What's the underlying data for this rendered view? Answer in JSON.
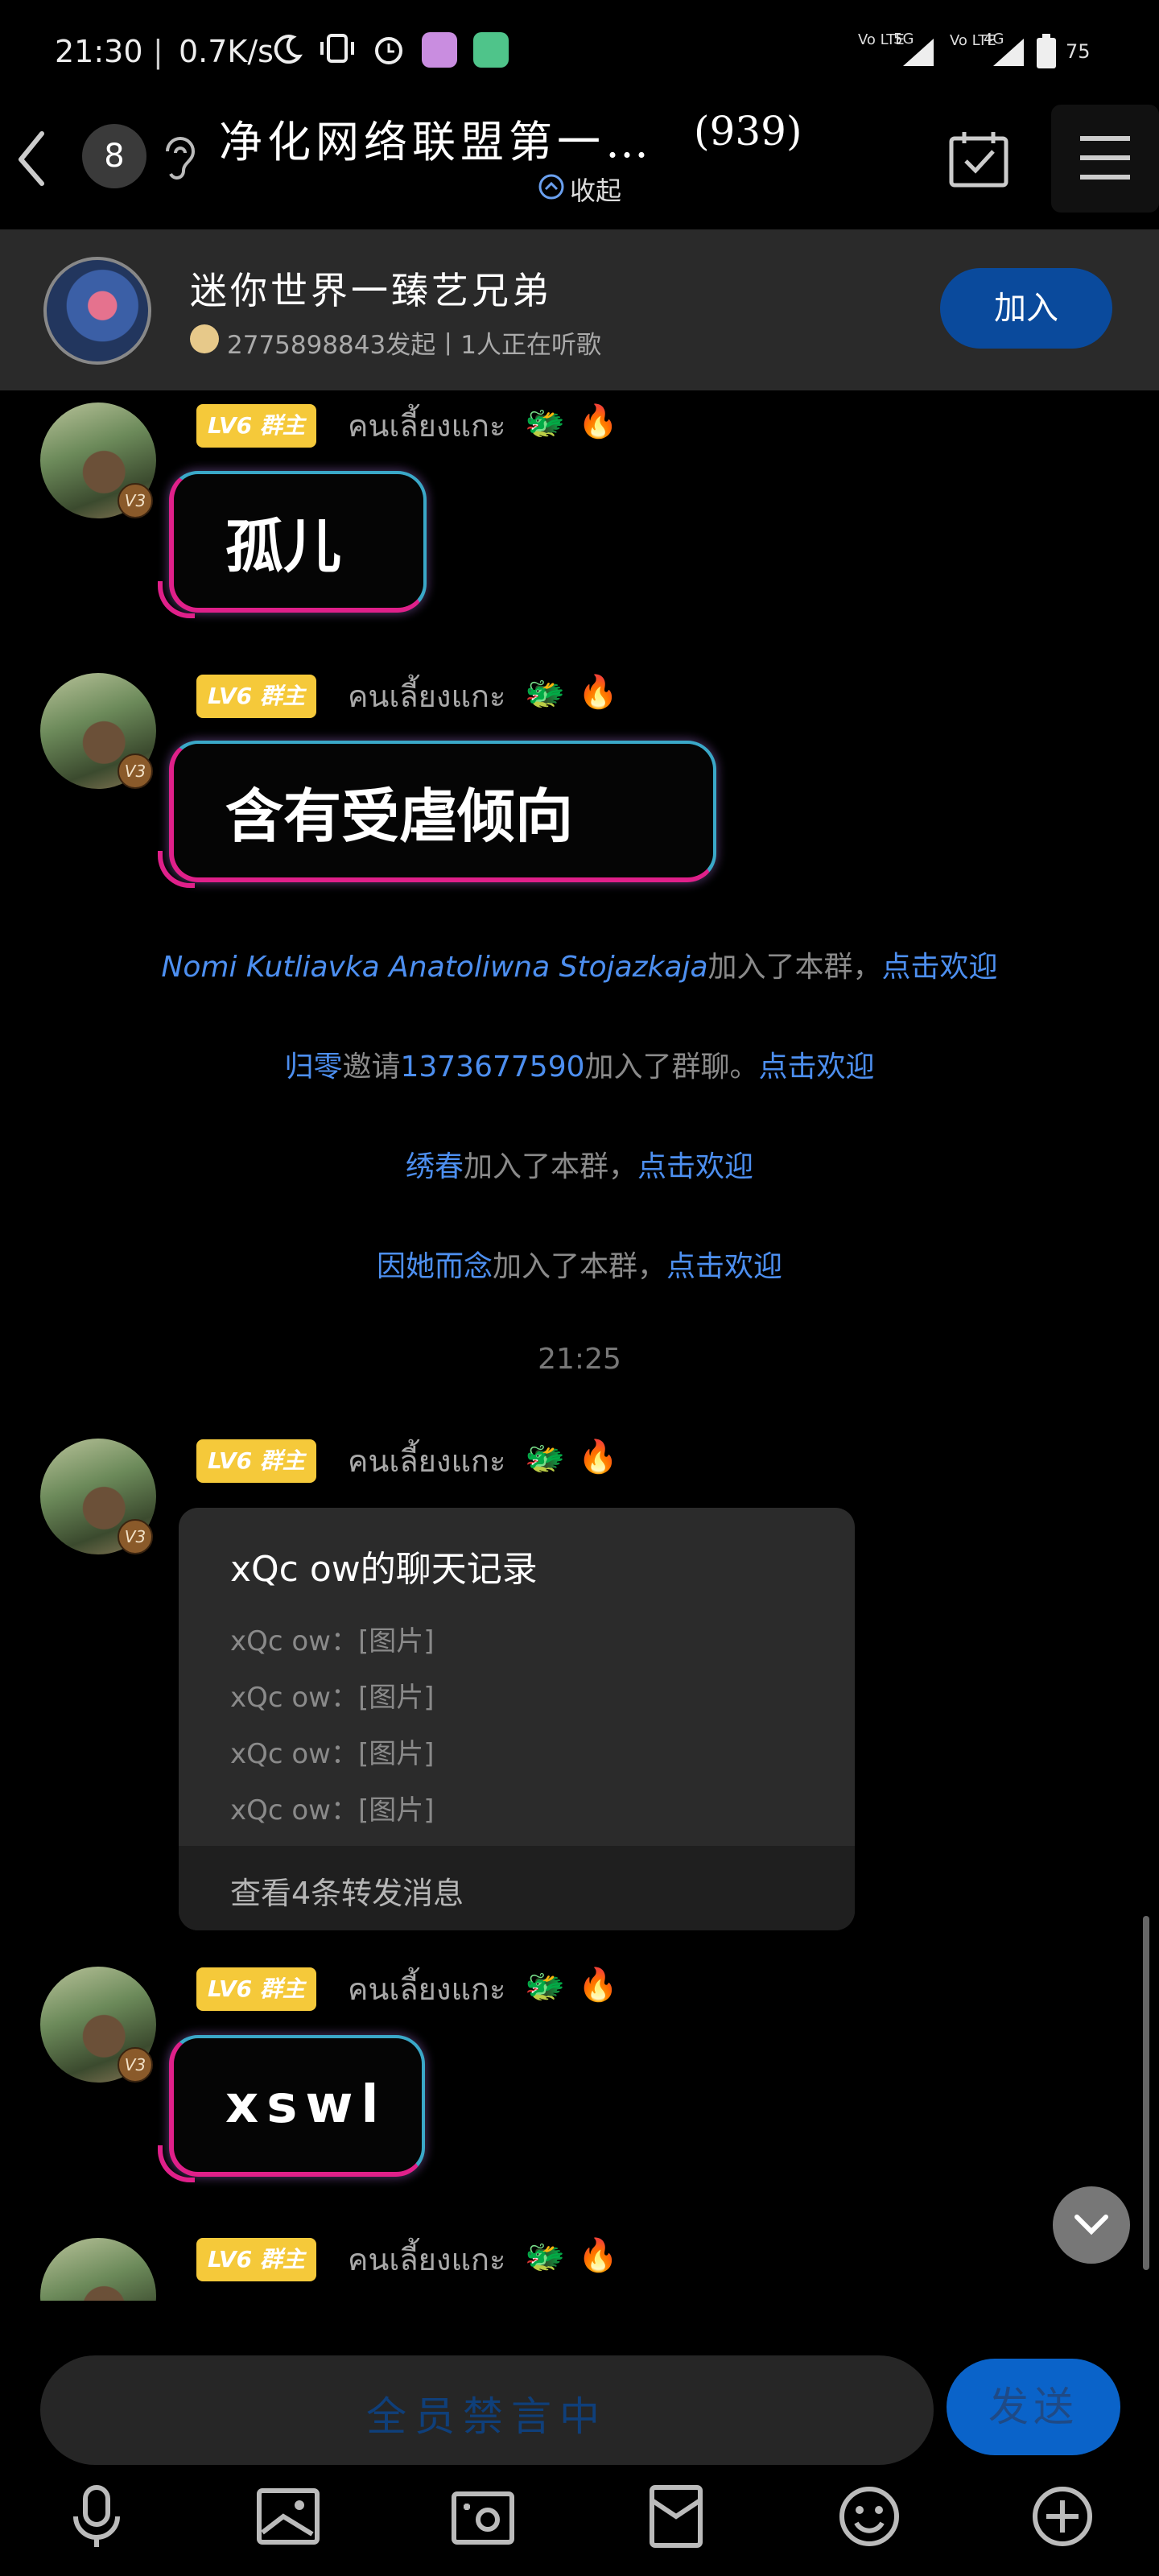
{
  "status_bar": {
    "time": "21:30",
    "speed": "0.7K/s",
    "network1": "5G",
    "network2": "4G",
    "lte1": "Vo LTE",
    "lte2": "Vo LTE",
    "battery": "75"
  },
  "title_bar": {
    "unread_count": "8",
    "title": "净化网络联盟第一…",
    "member_count": "(939)",
    "collapse_label": "收起"
  },
  "banner": {
    "title": "迷你世界一臻艺兄弟",
    "subtitle": "2775898843发起丨1人正在听歌",
    "join_label": "加入"
  },
  "messages": {
    "m1": {
      "level": "LV6",
      "role": "群主",
      "nickname": "คนเลี้ยงแกะ",
      "text": "孤儿",
      "badge": "V3"
    },
    "m2": {
      "level": "LV6",
      "role": "群主",
      "nickname": "คนเลี้ยงแกะ",
      "text": "含有受虐倾向",
      "badge": "V3"
    },
    "m3": {
      "level": "LV6",
      "role": "群主",
      "nickname": "คนเลี้ยงแกะ",
      "badge": "V3"
    },
    "m4": {
      "level": "LV6",
      "role": "群主",
      "nickname": "คนเลี้ยงแกะ",
      "text": "xswl",
      "badge": "V3"
    },
    "m5": {
      "level": "LV6",
      "role": "群主",
      "nickname": "คนเลี้ยงแกะ"
    }
  },
  "system": {
    "s1_name": "Nomi Kutliavka Anatoliwna Stojazkaja",
    "s1_text": "加入了本群，",
    "s1_link": "点击欢迎",
    "s2_name": "归零",
    "s2_text1": "邀请",
    "s2_num": "1373677590",
    "s2_text2": "加入了群聊。",
    "s2_link": "点击欢迎",
    "s3_name": "绣春",
    "s3_text": "加入了本群，",
    "s3_link": "点击欢迎",
    "s4_name": "因她而念",
    "s4_text": "加入了本群，",
    "s4_link": "点击欢迎",
    "timestamp": "21:25"
  },
  "forward": {
    "title": "xQc ow的聊天记录",
    "lines": [
      "xQc ow：[图片]",
      "xQc ow：[图片]",
      "xQc ow：[图片]",
      "xQc ow：[图片]"
    ],
    "footer": "查看4条转发消息"
  },
  "input": {
    "placeholder": "全员禁言中",
    "send_label": "发送"
  },
  "colors": {
    "accent_blue": "#0a63c9",
    "link_blue": "#4d8ff0",
    "level_gold": "#f5c93a",
    "bubble_pink": "#e0208a",
    "bubble_cyan": "#3aa8c8"
  }
}
